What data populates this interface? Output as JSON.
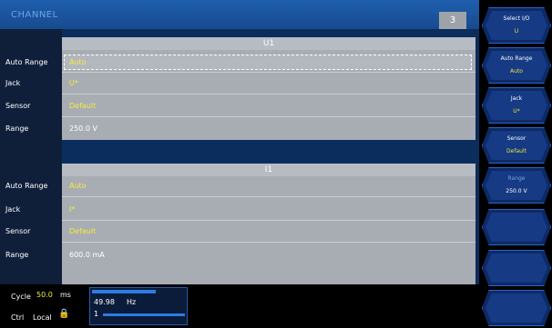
{
  "window": {
    "title": "CHANNEL",
    "tab_number": "3"
  },
  "sections": [
    {
      "header": "U1",
      "rows": [
        {
          "label": "Auto Range",
          "value": "Auto"
        },
        {
          "label": "Jack",
          "value": "U*"
        },
        {
          "label": "Sensor",
          "value": "Default"
        },
        {
          "label": "Range",
          "value": "250.0 V"
        }
      ]
    },
    {
      "header": "I1",
      "rows": [
        {
          "label": "Auto Range",
          "value": "Auto"
        },
        {
          "label": "Jack",
          "value": "I*"
        },
        {
          "label": "Sensor",
          "value": "Default"
        },
        {
          "label": "Range",
          "value": "600.0 mA"
        }
      ]
    }
  ],
  "softkeys": [
    {
      "label": "Select I/O",
      "value": "U"
    },
    {
      "label": "Auto Range",
      "value": "Auto"
    },
    {
      "label": "Jack",
      "value": "U*"
    },
    {
      "label": "Sensor",
      "value": "Default"
    },
    {
      "label": "Range",
      "value": "250.0 V"
    },
    {
      "label": "",
      "value": ""
    },
    {
      "label": "",
      "value": ""
    },
    {
      "label": "",
      "value": ""
    }
  ],
  "status": {
    "cycle_label": "Cycle",
    "cycle_value": "50.0",
    "cycle_unit": "ms",
    "ctrl_label": "Ctrl",
    "ctrl_value": "Local",
    "meter_freq": "49.98",
    "meter_unit": "Hz",
    "meter_index": "1"
  },
  "colors": {
    "accent": "#1f5fae",
    "value_text": "#f3ec3c",
    "panel": "#a8adb4"
  }
}
